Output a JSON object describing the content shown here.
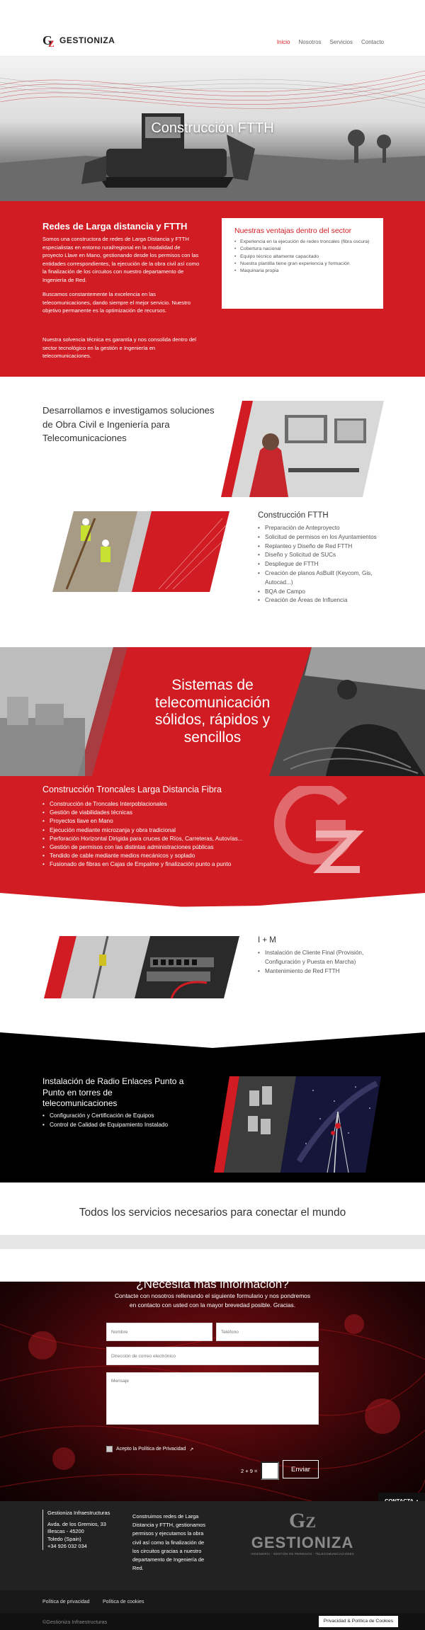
{
  "header": {
    "logo_text": "GESTIONIZA",
    "nav": [
      {
        "label": "Inicio",
        "active": true
      },
      {
        "label": "Nosotros",
        "active": false
      },
      {
        "label": "Servicios",
        "active": false
      },
      {
        "label": "Contacto",
        "active": false
      }
    ]
  },
  "hero": {
    "title": "Construcción FTTH"
  },
  "intro": {
    "title": "Redes de Larga distancia y FTTH",
    "p1": "Somos una constructora de redes de Larga Distancia y FTTH especialistas en entorno rural/regional en la modalidad de proyecto Llave en Mano, gestionando desde los permisos con las entidades correspondientes, la ejecución de la obra civil así como la finalización de los circuitos con nuestro departamento de Ingeniería de Red.",
    "p2": "Buscamos constantemente la excelencia en las telecomunicaciones, dando siempre el mejor servicio. Nuestro objetivo permanente es la optimización de recursos.",
    "p3": "Nuestra solvencia técnica es garantía y nos consolida dentro del sector tecnológico en la gestión e Ingeniería en telecomunicaciones.",
    "advantages_title": "Nuestras ventajas dentro del sector",
    "advantages": [
      "Experiencia en la ejecución de redes troncales (fibra oscura)",
      "Cobertura nacional",
      "Equipo técnico altamente capacitado",
      "Nuestra plantilla tiene gran experiencia y formación",
      "Maquinaria propia"
    ]
  },
  "services": {
    "heading": "Desarrollamos e investigamos soluciones de Obra Civil e Ingeniería para Telecomunicaciones",
    "ftth_title": "Construcción FTTH",
    "ftth_items": [
      "Preparación de Anteproyecto",
      "Solicitud de permisos en los Ayuntamientos",
      "Replanteo y Diseño de Red FTTH",
      "Diseño y Solicitud de SUCs",
      "Despliegue de FTTH",
      "Creación de planos AsBuilt (Keycom, Gis, Autocad...)",
      "BQA de Campo",
      "Creación de Áreas de Influencia"
    ]
  },
  "systems": {
    "text": "Sistemas de telecomunicación sólidos, rápidos y sencillos"
  },
  "troncales": {
    "title": "Construcción Troncales Larga Distancia Fibra",
    "items": [
      "Construcción de Troncales Interpoblacionales",
      "Gestión de viabilidades técnicas",
      "Proyectos llave en Mano",
      "Ejecución mediante microzanja y obra tradicional",
      "Perforación Horizontal Dirigida para cruces de Ríos, Carreteras, Autovías...",
      "Gestión de permisos con las distintas administraciones públicas",
      "Tendido de cable mediante medios mecánicos y soplado",
      "Fusionado de fibras en Cajas de Empalme y finalización punto a punto"
    ]
  },
  "im": {
    "title": "I + M",
    "items": [
      "Instalación de Cliente Final (Provisión, Configuración y Puesta en Marcha)",
      "Mantenimiento de Red FTTH"
    ]
  },
  "radio": {
    "title": "Instalación de Radio Enlaces Punto a Punto en torres de telecomunicaciones",
    "items": [
      "Configuración y Certificación de Equipos",
      "Control de Calidad de Equipamiento Instalado"
    ]
  },
  "tagline": "Todos los servicios necesarios para conectar el mundo",
  "contact": {
    "title": "¿Necesita más información?",
    "desc": "Contacte con nosotros rellenando el siguiente formulario y nos pondremos en contacto con usted con la mayor brevedad posible. Gracias.",
    "name_placeholder": "Nombre",
    "phone_placeholder": "Teléfono",
    "email_placeholder": "Dirección de correo electrónico",
    "message_placeholder": "Mensaje",
    "privacy_label": "Acepto la Política de Privacidad",
    "captcha": "2 + 9 =",
    "send_label": "Enviar",
    "tab_label": "CONTACTA"
  },
  "footer": {
    "company": "Gestioniza Infraestructuras",
    "address1": "Avda. de los Gremios, 33",
    "address2": "Illescas - 45200",
    "address3": "Toledo (Spain)",
    "phone": "+34 926 032 034",
    "about": "Construimos redes de Larga Distancia y FTTH, gestionamos permisos y ejecutamos la obra civil así como la finalización de los circuitos gracias a nuestro departamento de Ingeniería de Red.",
    "logo_word": "GESTIONIZA",
    "logo_sub": "INGENIERÍA · GESTIÓN DE PERMISOS · TELECOMUNICACIONES",
    "link_privacy": "Política de privacidad",
    "link_cookies": "Política de cookies",
    "copyright": "©Gestioniza Infraestructuras",
    "badge": "Privacidad & Política de Cookies"
  },
  "colors": {
    "accent": "#d01c22",
    "dark": "#222222"
  }
}
